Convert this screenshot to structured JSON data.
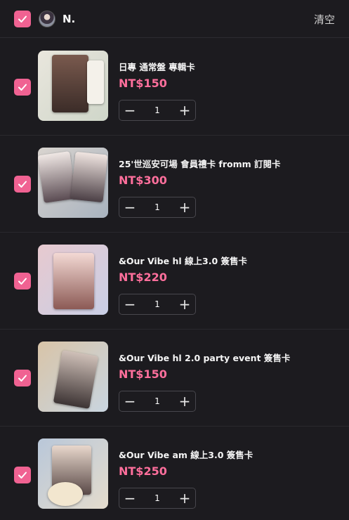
{
  "header": {
    "store_name": "N.",
    "clear_label": "清空"
  },
  "items": [
    {
      "title": "日專 通常盤 專輯卡",
      "price": "NT$150",
      "quantity": "1"
    },
    {
      "title": "25'世巡安可場 會員禮卡 fromm 訂閱卡",
      "price": "NT$300",
      "quantity": "1"
    },
    {
      "title": "&Our Vibe hl 線上3.0 簽售卡",
      "price": "NT$220",
      "quantity": "1"
    },
    {
      "title": "&Our Vibe hl 2.0 party event 簽售卡",
      "price": "NT$150",
      "quantity": "1"
    },
    {
      "title": "&Our Vibe am 線上3.0 簽售卡",
      "price": "NT$250",
      "quantity": "1"
    }
  ],
  "stepper": {
    "minus_symbol": "−",
    "plus_symbol": "+"
  },
  "colors": {
    "background": "#1c1b1f",
    "accent": "#f06292",
    "price": "#ff6f9c"
  },
  "icons": [
    "check-icon",
    "minus-icon",
    "plus-icon"
  ]
}
